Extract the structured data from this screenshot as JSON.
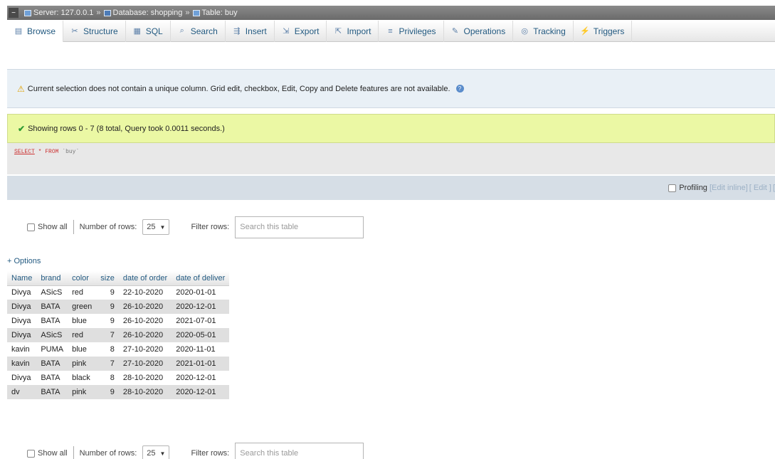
{
  "breadcrumb": {
    "server": "Server: 127.0.0.1",
    "database": "Database: shopping",
    "table": "Table: buy"
  },
  "tabs": [
    {
      "label": "Browse",
      "icon": "browse-icon"
    },
    {
      "label": "Structure",
      "icon": "structure-icon"
    },
    {
      "label": "SQL",
      "icon": "sql-icon"
    },
    {
      "label": "Search",
      "icon": "search-icon"
    },
    {
      "label": "Insert",
      "icon": "insert-icon"
    },
    {
      "label": "Export",
      "icon": "export-icon"
    },
    {
      "label": "Import",
      "icon": "import-icon"
    },
    {
      "label": "Privileges",
      "icon": "privileges-icon"
    },
    {
      "label": "Operations",
      "icon": "operations-icon"
    },
    {
      "label": "Tracking",
      "icon": "tracking-icon"
    },
    {
      "label": "Triggers",
      "icon": "triggers-icon"
    }
  ],
  "notice": {
    "text": "Current selection does not contain a unique column. Grid edit, checkbox, Edit, Copy and Delete features are not available."
  },
  "success": {
    "text": "Showing rows 0 - 7 (8 total, Query took 0.0011 seconds.)"
  },
  "sql": {
    "select": "SELECT",
    "star": "*",
    "from": "FROM",
    "table": "`buy`"
  },
  "profiling": {
    "label": "Profiling",
    "edit_inline": "[Edit inline]",
    "edit": "[ Edit ]",
    "tail": "["
  },
  "nav": {
    "show_all": "Show all",
    "number_of_rows_label": "Number of rows:",
    "rows_value": "25",
    "filter_label": "Filter rows:",
    "filter_placeholder": "Search this table"
  },
  "options_link": "+ Options",
  "table": {
    "headers": [
      "Name",
      "brand",
      "color",
      "size",
      "date of order",
      "date of deliver"
    ],
    "rows": [
      [
        "Divya",
        "ASicS",
        "red",
        "9",
        "22-10-2020",
        "2020-01-01"
      ],
      [
        "Divya",
        "BATA",
        "green",
        "9",
        "26-10-2020",
        "2020-12-01"
      ],
      [
        "Divya",
        "BATA",
        "blue",
        "9",
        "26-10-2020",
        "2021-07-01"
      ],
      [
        "Divya",
        "ASicS",
        "red",
        "7",
        "26-10-2020",
        "2020-05-01"
      ],
      [
        "kavin",
        "PUMA",
        "blue",
        "8",
        "27-10-2020",
        "2020-11-01"
      ],
      [
        "kavin",
        "BATA",
        "pink",
        "7",
        "27-10-2020",
        "2021-01-01"
      ],
      [
        "Divya",
        "BATA",
        "black",
        "8",
        "28-10-2020",
        "2020-12-01"
      ],
      [
        "dv",
        "BATA",
        "pink",
        "9",
        "28-10-2020",
        "2020-12-01"
      ]
    ]
  },
  "colors": {
    "link": "#235a81",
    "success_bg": "#ebf8a4",
    "notice_bg": "#e9f0f6"
  }
}
